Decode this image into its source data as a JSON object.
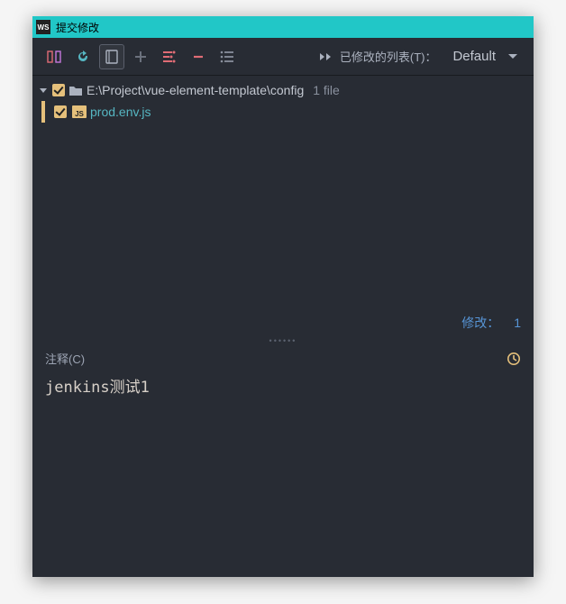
{
  "window": {
    "title": "提交修改",
    "app_icon": "WS"
  },
  "toolbar": {
    "modified_label": "已修改的列表(T)：",
    "dropdown_selected": "Default"
  },
  "tree": {
    "root": {
      "path": "E:\\Project\\vue-element-template\\config",
      "file_count": "1 file"
    },
    "file": {
      "name": "prod.env.js",
      "badge": "JS"
    }
  },
  "status": {
    "modified_label": "修改：",
    "modified_count": "1"
  },
  "comment": {
    "label": "注释(C)",
    "value": "jenkins测试1"
  }
}
